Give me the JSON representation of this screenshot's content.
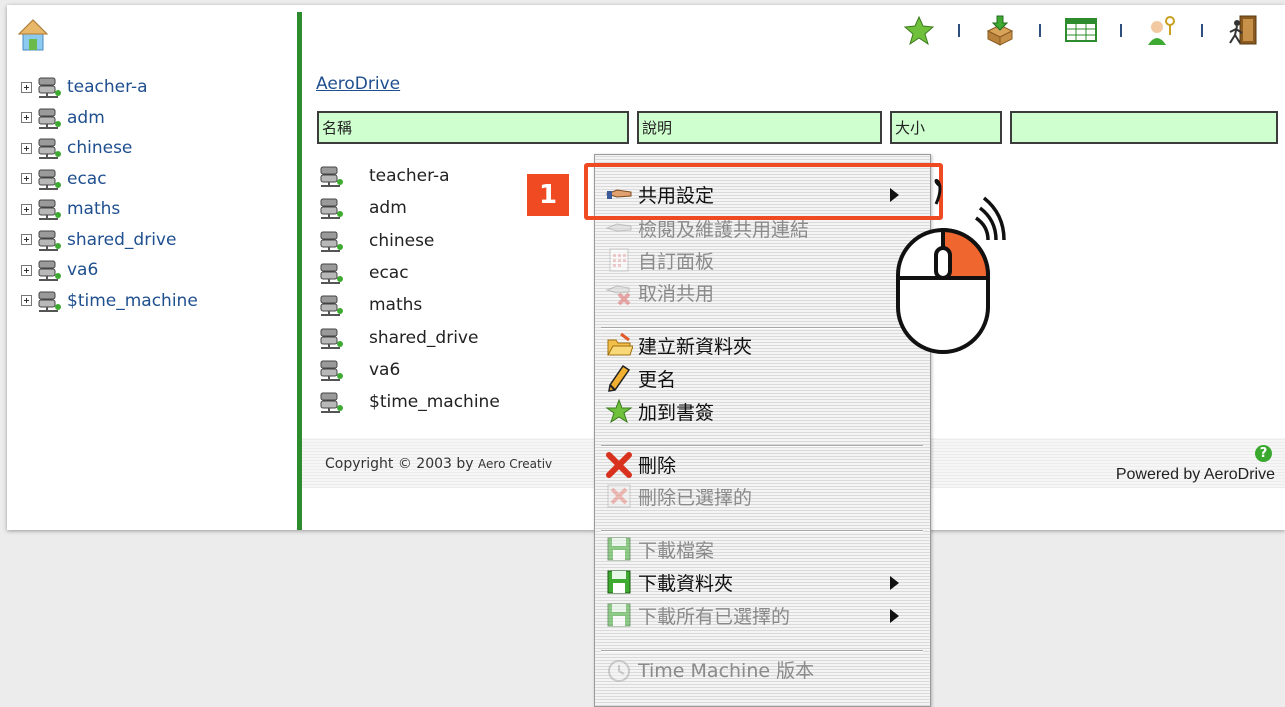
{
  "tree": {
    "items": [
      {
        "label": "teacher-a"
      },
      {
        "label": "adm"
      },
      {
        "label": "chinese"
      },
      {
        "label": "ecac"
      },
      {
        "label": "maths"
      },
      {
        "label": "shared_drive"
      },
      {
        "label": "va6"
      },
      {
        "label": "$time_machine"
      }
    ]
  },
  "toolbar": {
    "icons": [
      "bookmark-star-icon",
      "upload-box-icon",
      "table-view-icon",
      "user-key-icon",
      "logout-door-icon"
    ]
  },
  "breadcrumb": "AeroDrive",
  "table": {
    "headers": [
      "名稱",
      "說明",
      "大小",
      ""
    ]
  },
  "files": [
    {
      "name": "teacher-a"
    },
    {
      "name": "adm"
    },
    {
      "name": "chinese"
    },
    {
      "name": "ecac"
    },
    {
      "name": "maths"
    },
    {
      "name": "shared_drive"
    },
    {
      "name": "va6"
    },
    {
      "name": "$time_machine"
    }
  ],
  "footer": {
    "copyright_prefix": "Copyright © 2003 by ",
    "copyright_org": "Aero Creativ",
    "powered": "Powered by AeroDrive",
    "help": "?"
  },
  "context_menu": {
    "items": [
      {
        "label": "共用設定",
        "icon": "share-hand-icon",
        "enabled": true,
        "submenu": true
      },
      {
        "label": "檢閱及維護共用連結",
        "icon": "share-link-icon",
        "enabled": false,
        "submenu": false
      },
      {
        "label": "自訂面板",
        "icon": "panel-grid-icon",
        "enabled": false,
        "submenu": false
      },
      {
        "label": "取消共用",
        "icon": "unshare-icon",
        "enabled": false,
        "submenu": false
      },
      {
        "label": "建立新資料夾",
        "icon": "new-folder-icon",
        "enabled": true,
        "submenu": false
      },
      {
        "label": "更名",
        "icon": "pencil-icon",
        "enabled": true,
        "submenu": false
      },
      {
        "label": "加到書簽",
        "icon": "star-icon",
        "enabled": true,
        "submenu": false
      },
      {
        "label": "刪除",
        "icon": "delete-x-icon",
        "enabled": true,
        "submenu": false
      },
      {
        "label": "刪除已選擇的",
        "icon": "delete-selected-icon",
        "enabled": false,
        "submenu": false
      },
      {
        "label": "下載檔案",
        "icon": "floppy-icon",
        "enabled": false,
        "submenu": false
      },
      {
        "label": "下載資料夾",
        "icon": "floppy-icon",
        "enabled": true,
        "submenu": true
      },
      {
        "label": "下載所有已選擇的",
        "icon": "floppy-icon",
        "enabled": false,
        "submenu": true
      },
      {
        "label": "Time Machine 版本",
        "icon": "clock-icon",
        "enabled": false,
        "submenu": false
      }
    ]
  },
  "annotation": {
    "step": "1",
    "accent": "#f04a23"
  },
  "colors": {
    "link": "#1f4f8f",
    "header_bg": "#cfffcf",
    "divider": "#2e8b2e"
  }
}
